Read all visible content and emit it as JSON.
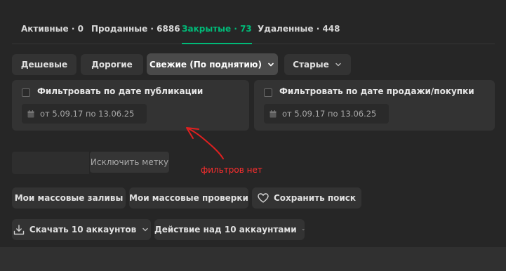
{
  "tabs": [
    {
      "label": "Активные · 0",
      "active": false
    },
    {
      "label": "Проданные · 6886",
      "active": false
    },
    {
      "label": "Закрытые · 73",
      "active": true
    },
    {
      "label": "Удаленные · 448",
      "active": false
    }
  ],
  "sort": {
    "cheap": "Дешевые",
    "expensive": "Дорогие",
    "fresh": "Свежие (По поднятию)",
    "old": "Старые"
  },
  "filters": {
    "publication": {
      "label": "Фильтровать по дате публикации",
      "range": "от 5.09.17 по 13.06.25"
    },
    "sale": {
      "label": "Фильтровать по дате продажи/покупки",
      "range": "от 5.09.17 по 13.06.25"
    }
  },
  "tag": {
    "exclude_label": "Исключить метку",
    "value": ""
  },
  "annotation": {
    "text": "фильтров нет",
    "color": "#ff2e2e"
  },
  "actions": {
    "mass_uploads": "Мои массовые заливы",
    "mass_checks": "Мои массовые проверки",
    "save_search": "Сохранить поиск",
    "download": "Скачать 10 аккаунтов",
    "bulk_action": "Действие над 10 аккаунтами"
  },
  "colors": {
    "accent": "#00ba78",
    "background": "#262626",
    "surface": "#333333"
  }
}
